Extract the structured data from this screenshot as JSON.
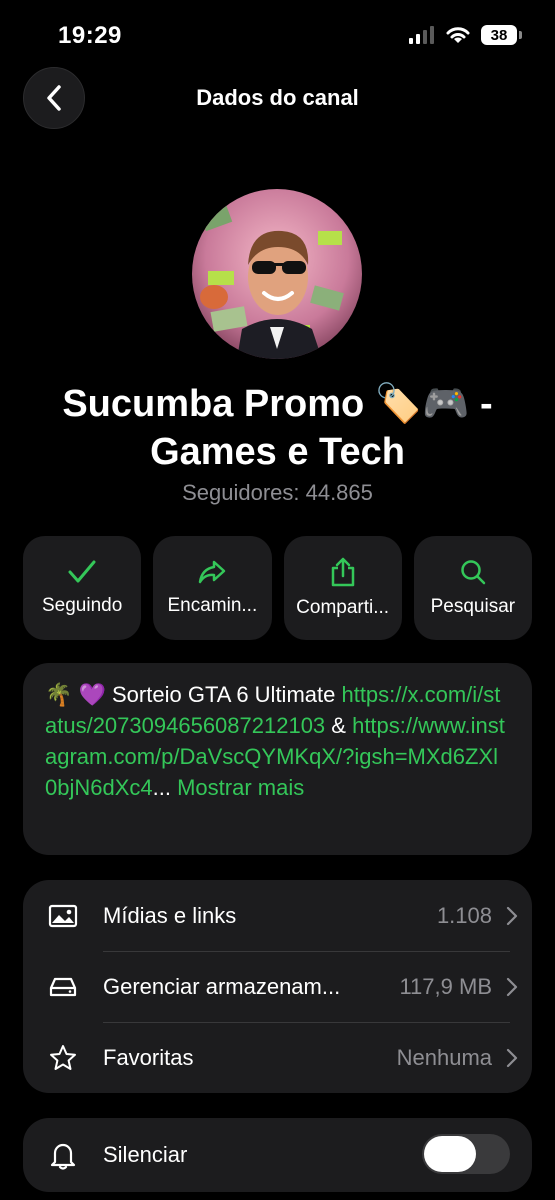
{
  "status_bar": {
    "time": "19:29",
    "battery": "38"
  },
  "header": {
    "title": "Dados do canal"
  },
  "channel": {
    "name_line1": "Sucumba Promo 🏷️🎮  -",
    "name_line2": "Games e Tech",
    "followers": "Seguidores: 44.865"
  },
  "actions": [
    {
      "label": "Seguindo",
      "icon": "checkmark-icon"
    },
    {
      "label": "Encamin...",
      "icon": "forward-icon"
    },
    {
      "label": "Comparti...",
      "icon": "share-icon"
    },
    {
      "label": "Pesquisar",
      "icon": "search-icon"
    }
  ],
  "description": {
    "prefix": "🌴 💜 Sorteio GTA 6 Ultimate ",
    "link1": "https://x.com/i/status/2073094656087212103",
    "joiner": " & ",
    "link2": "https://www.instagram.com/p/DaVscQYMKqX/?igsh=MXd6ZXl0bjN6dXc4",
    "ellipsis": "...",
    "more": " Mostrar mais"
  },
  "list": [
    {
      "label": "Mídias e links",
      "value": "1.108",
      "icon": "image-icon"
    },
    {
      "label": "Gerenciar armazenam...",
      "value": "117,9 MB",
      "icon": "storage-icon"
    },
    {
      "label": "Favoritas",
      "value": "Nenhuma",
      "icon": "star-icon"
    }
  ],
  "mute": {
    "label": "Silenciar",
    "icon": "bell-icon",
    "enabled": false
  },
  "colors": {
    "accent": "#34c759",
    "card": "#1c1c1e",
    "secondary_text": "#8e8e93"
  }
}
